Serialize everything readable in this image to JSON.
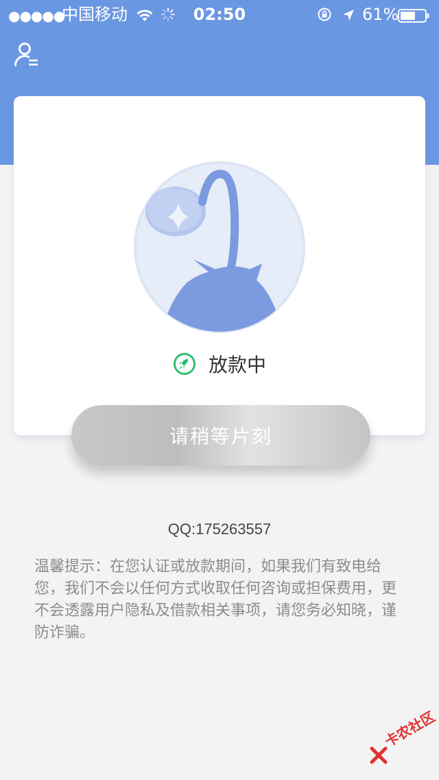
{
  "status_bar": {
    "signal": "●●●●●",
    "carrier": "中国移动",
    "time": "02:50",
    "battery": "61%"
  },
  "card": {
    "status_text": "放款中"
  },
  "button": {
    "label": "请稍等片刻"
  },
  "qq": "QQ:175263557",
  "tip": "温馨提示：在您认证或放款期间，如果我们有致电给您，我们不会以任何方式收取任何咨询或担保费用，更不会透露用户隐私及借款相关事项，请您务必知晓，谨防诈骗。",
  "watermark": "卡农社区",
  "colors": {
    "header_bg": "#6a97e2",
    "page_bg": "#f3f3f4",
    "accent_green": "#2fbf71",
    "illustration_blue": "#7b9ae0"
  }
}
